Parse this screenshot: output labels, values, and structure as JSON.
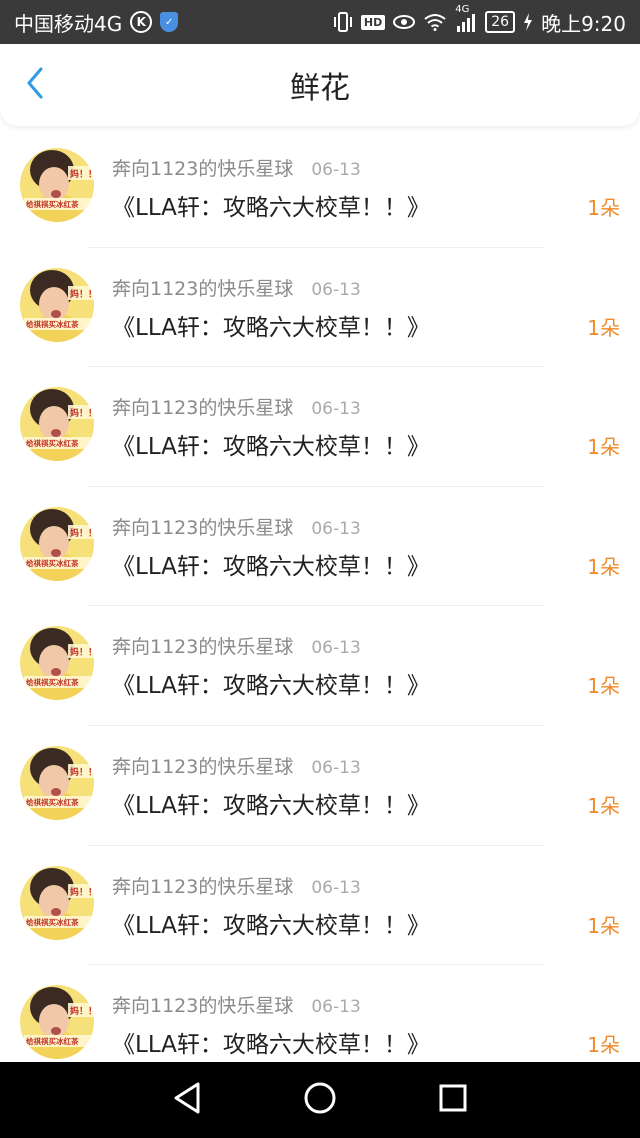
{
  "status_bar": {
    "carrier": "中国移动4G",
    "k_label": "K",
    "hd_label": "HD",
    "net_label": "4G",
    "battery": "26",
    "time": "晚上9:20"
  },
  "header": {
    "title": "鲜花"
  },
  "colors": {
    "accent_blue": "#2f9ae6",
    "count_orange": "#f08a2a",
    "status_bg": "#3a3a3a"
  },
  "items": [
    {
      "user": "奔向1123的快乐星球",
      "date": "06-13",
      "message": "《LLA轩：攻略六大校草！！》",
      "count": "1朵"
    },
    {
      "user": "奔向1123的快乐星球",
      "date": "06-13",
      "message": "《LLA轩：攻略六大校草！！》",
      "count": "1朵"
    },
    {
      "user": "奔向1123的快乐星球",
      "date": "06-13",
      "message": "《LLA轩：攻略六大校草！！》",
      "count": "1朵"
    },
    {
      "user": "奔向1123的快乐星球",
      "date": "06-13",
      "message": "《LLA轩：攻略六大校草！！》",
      "count": "1朵"
    },
    {
      "user": "奔向1123的快乐星球",
      "date": "06-13",
      "message": "《LLA轩：攻略六大校草！！》",
      "count": "1朵"
    },
    {
      "user": "奔向1123的快乐星球",
      "date": "06-13",
      "message": "《LLA轩：攻略六大校草！！》",
      "count": "1朵"
    },
    {
      "user": "奔向1123的快乐星球",
      "date": "06-13",
      "message": "《LLA轩：攻略六大校草！！》",
      "count": "1朵"
    },
    {
      "user": "奔向1123的快乐星球",
      "date": "06-13",
      "message": "《LLA轩：攻略六大校草！！》",
      "count": "1朵"
    }
  ],
  "avatar_caption": {
    "line1": "妈！！",
    "line2": "给祺祺买冰红茶"
  },
  "icons": {
    "back": "chevron-left-icon",
    "nav_back": "triangle-back-icon",
    "nav_home": "circle-home-icon",
    "nav_recent": "square-recent-icon"
  }
}
